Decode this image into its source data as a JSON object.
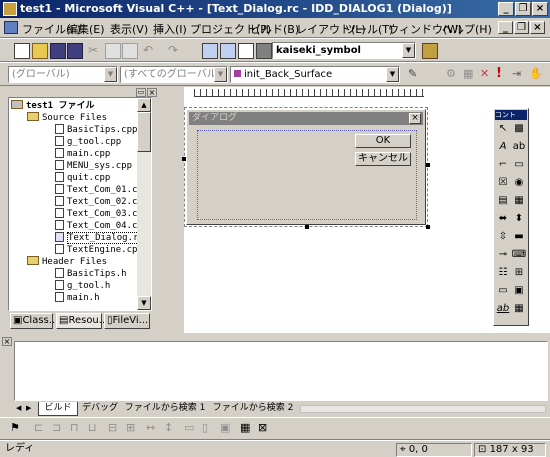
{
  "window": {
    "title": "test1 - Microsoft Visual C++ - [Text_Dialog.rc - IDD_DIALOG1 (Dialog)]",
    "minimize": "_",
    "restore": "❐",
    "close": "×"
  },
  "menu": [
    "ファイル(F)",
    "編集(E)",
    "表示(V)",
    "挿入(I)",
    "プロジェクト(P)",
    "ビルド(B)",
    "レイアウト(L)",
    "ツール(T)",
    "ウィンドウ(W)",
    "ヘルプ(H)"
  ],
  "toolbar": {
    "find_combo_value": "kaiseki_symbol"
  },
  "wizardbar": {
    "class_combo": "(グローバル)",
    "members_combo": "(すべてのグローバル メンバ)",
    "function_combo": "init_Back_Surface"
  },
  "workspace": {
    "tree": [
      {
        "label": "test1 ファイル",
        "kind": "root"
      },
      {
        "label": "Source Files",
        "kind": "folder"
      },
      {
        "label": "BasicTips.cpp",
        "kind": "file"
      },
      {
        "label": "g_tool.cpp",
        "kind": "file"
      },
      {
        "label": "main.cpp",
        "kind": "file"
      },
      {
        "label": "MENU_sys.cpp",
        "kind": "file"
      },
      {
        "label": "quit.cpp",
        "kind": "file"
      },
      {
        "label": "Text_Com_01.cpp",
        "kind": "file"
      },
      {
        "label": "Text_Com_02.cpp",
        "kind": "file"
      },
      {
        "label": "Text_Com_03.cpp",
        "kind": "file"
      },
      {
        "label": "Text_Com_04.cpp",
        "kind": "file"
      },
      {
        "label": "Text_Dialog.rc",
        "kind": "file"
      },
      {
        "label": "TextEngine.cpp",
        "kind": "file"
      },
      {
        "label": "Header Files",
        "kind": "folder"
      },
      {
        "label": "BasicTips.h",
        "kind": "file"
      },
      {
        "label": "g_tool.h",
        "kind": "file"
      },
      {
        "label": "main.h",
        "kind": "file"
      }
    ],
    "tabs": [
      "Class...",
      "Resou...",
      "FileVi..."
    ]
  },
  "dialog": {
    "caption": "ダイアログ",
    "ok_label": "OK",
    "cancel_label": "キャンセル"
  },
  "controls_palette": {
    "title": "コントロ..."
  },
  "output": {
    "tabs": [
      "ビルド",
      "デバッグ",
      "ファイルから検索 1",
      "ファイルから検索 2"
    ]
  },
  "statusbar": {
    "message": "レディ",
    "position": "0, 0",
    "size": "187 x 93"
  }
}
